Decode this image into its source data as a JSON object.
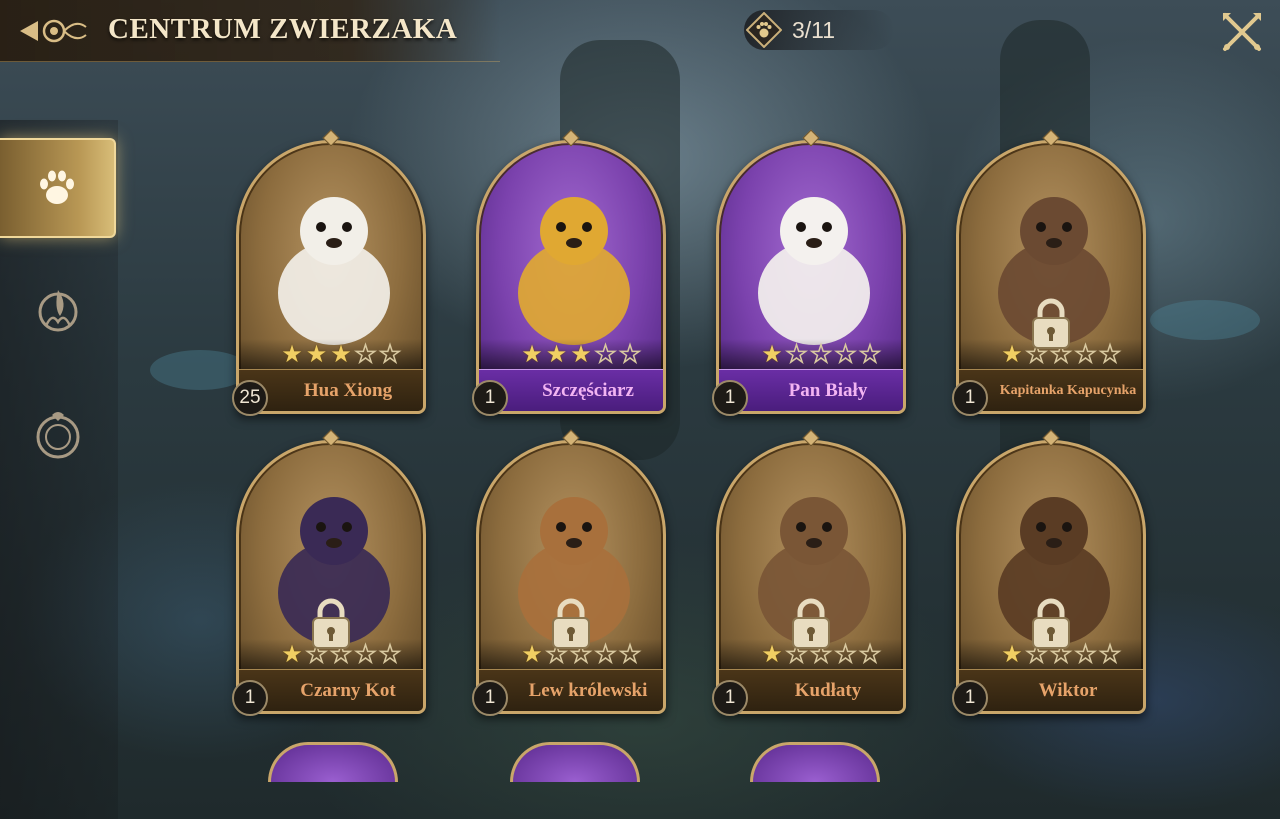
{
  "header": {
    "title": "CENTRUM ZWIERZAKA",
    "collection_count": "3/11"
  },
  "sidebar": {
    "tabs": [
      {
        "icon": "paw-icon",
        "active": true
      },
      {
        "icon": "flame-emblem-icon",
        "active": false
      },
      {
        "icon": "ring-emblem-icon",
        "active": false
      }
    ]
  },
  "pets": [
    {
      "name": "Hua Xiong",
      "level": "25",
      "stars": 3,
      "rarity": "gold",
      "locked": false
    },
    {
      "name": "Szczęściarz",
      "level": "1",
      "stars": 3,
      "rarity": "purple",
      "locked": false
    },
    {
      "name": "Pan Biały",
      "level": "1",
      "stars": 1,
      "rarity": "purple",
      "locked": false
    },
    {
      "name": "Kapitanka Kapucynka",
      "level": "1",
      "stars": 1,
      "rarity": "gold",
      "locked": true
    },
    {
      "name": "Czarny Kot",
      "level": "1",
      "stars": 1,
      "rarity": "gold",
      "locked": true
    },
    {
      "name": "Lew królewski",
      "level": "1",
      "stars": 1,
      "rarity": "gold",
      "locked": true
    },
    {
      "name": "Kudłaty",
      "level": "1",
      "stars": 1,
      "rarity": "gold",
      "locked": true
    },
    {
      "name": "Wiktor",
      "level": "1",
      "stars": 1,
      "rarity": "gold",
      "locked": true
    }
  ],
  "max_stars": 5,
  "colors": {
    "gold_frame": "#c9a66a",
    "purple_card": "#7b42ad",
    "star": "#f1cf63",
    "title": "#f4e6c8"
  }
}
